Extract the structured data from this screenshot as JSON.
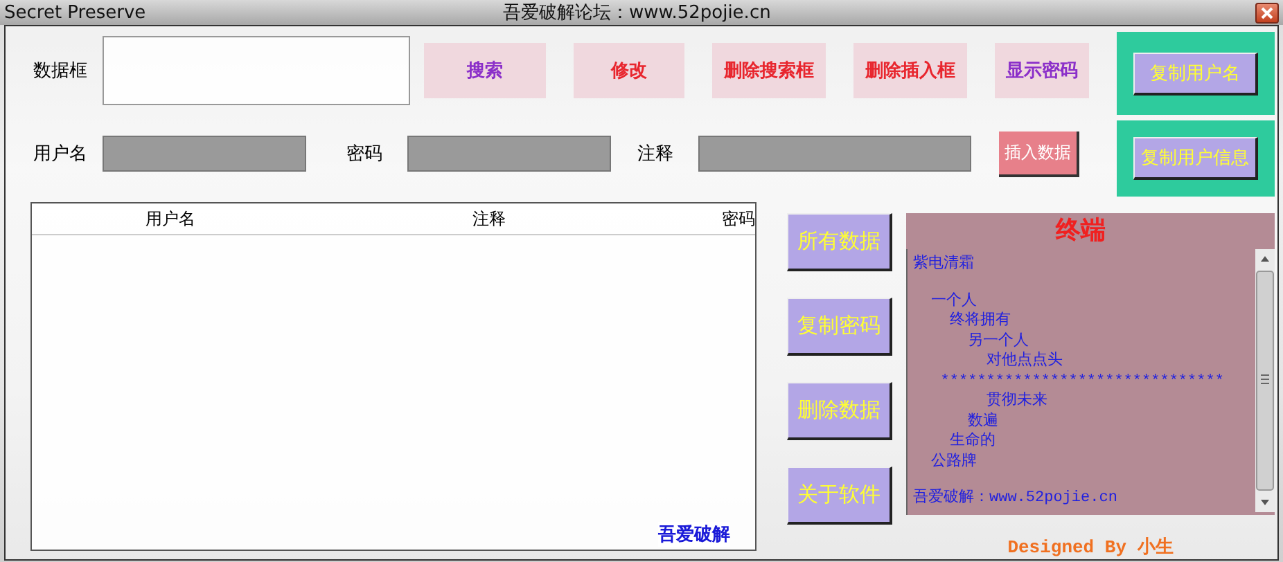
{
  "window": {
    "title": "Secret Preserve",
    "caption": "吾爱破解论坛：www.52pojie.cn"
  },
  "data_box": {
    "label": "数据框"
  },
  "top_buttons": [
    {
      "label": "搜索",
      "color": "#8b2fc9"
    },
    {
      "label": "修改",
      "color": "#e8262e"
    },
    {
      "label": "删除搜索框",
      "color": "#e8262e"
    },
    {
      "label": "删除插入框",
      "color": "#e8262e"
    },
    {
      "label": "显示密码",
      "color": "#8b2fc9"
    }
  ],
  "fields": [
    {
      "label": "用户名"
    },
    {
      "label": "密码"
    },
    {
      "label": "注释"
    }
  ],
  "insert_button": "插入数据",
  "copy_buttons": [
    "复制用户名",
    "复制用户信息"
  ],
  "table": {
    "columns": [
      "用户名",
      "注释",
      "密码"
    ],
    "watermark": "吾爱破解"
  },
  "side_buttons": [
    "所有数据",
    "复制密码",
    "删除数据",
    "关于软件"
  ],
  "terminal": {
    "title": "终端",
    "heading": "紫电清霜",
    "poem": [
      "  一个人",
      "    终将拥有",
      "      另一个人",
      "        对他点点头",
      "   *******************************",
      "        贯彻未来",
      "      数遍",
      "    生命的",
      "  公路牌"
    ],
    "footer": "吾爱破解：www.52pojie.cn"
  },
  "credit": "Designed By 小生"
}
